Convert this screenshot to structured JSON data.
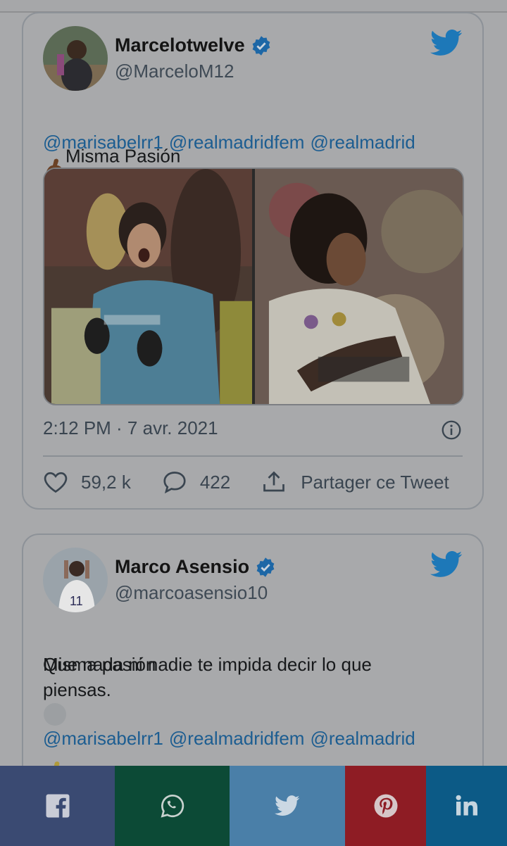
{
  "tweets": [
    {
      "name": "Marcelotwelve",
      "handle": "@MarceloM12",
      "text": "Misma Pasión",
      "mentions": [
        "@marisabelrr1",
        "@realmadridfem",
        "@realmadrid"
      ],
      "time": "2:12 PM · 7 avr. 2021",
      "likes": "59,2 k",
      "replies": "422",
      "share_label": "Partager ce Tweet"
    },
    {
      "name": "Marco Asensio",
      "handle": "@marcoasensio10",
      "text_line1": "Misma pasión",
      "text_rest": "Que nada ni nadie te impida decir lo que\npiensas.",
      "mentions": [
        "@marisabelrr1",
        "@realmadridfem",
        "@realmadrid"
      ]
    }
  ],
  "share_bar": {
    "colors": {
      "facebook": "#3a4a72",
      "whatsapp": "#0c4a36",
      "twitter": "#4a7fa8",
      "pinterest": "#8e1c24",
      "linkedin": "#0c5a86"
    }
  },
  "icons": [
    "verified-icon",
    "twitter-bird-icon",
    "info-icon",
    "heart-icon",
    "reply-icon",
    "share-icon",
    "facebook-icon",
    "whatsapp-icon",
    "pinterest-icon",
    "linkedin-icon"
  ]
}
